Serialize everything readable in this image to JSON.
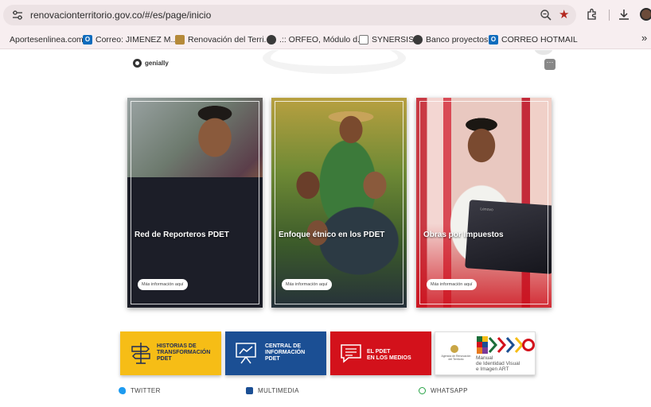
{
  "browser": {
    "url": "renovacionterritorio.gov.co/#/es/page/inicio",
    "bookmarks": [
      {
        "label": "Aportesenlinea.com",
        "icon": "none"
      },
      {
        "label": "Correo: JIMENEZ M...",
        "icon": "outlook-icon"
      },
      {
        "label": "Renovación del Terri...",
        "icon": "shield-icon"
      },
      {
        "label": ".:: ORFEO, Módulo d...",
        "icon": "globe-icon"
      },
      {
        "label": "SYNERSIS",
        "icon": "chart-icon"
      },
      {
        "label": "Banco proyectos",
        "icon": "globe-icon"
      },
      {
        "label": "CORREO HOTMAIL",
        "icon": "outlook-icon"
      }
    ],
    "more_bookmarks": "»"
  },
  "page": {
    "logo_text": "genially",
    "more_button": "···",
    "cards": [
      {
        "title": "Red de Reporteros PDET",
        "button": "Más información aquí"
      },
      {
        "title": "Enfoque étnico en los PDET",
        "button": "Más información aquí"
      },
      {
        "title": "Obras por Impuestos",
        "button": "Más información aquí"
      }
    ],
    "tablet_brand": "Lenovo",
    "banners": [
      {
        "label": "HISTORIAS DE\nTRANSFORMACIÓN\nPDET",
        "color": "#f6bd16"
      },
      {
        "label": "CENTRAL DE\nINFORMACIÓN\nPDET",
        "color": "#1b4f94"
      },
      {
        "label": "EL PDET\nEN LOS MEDIOS",
        "color": "#d3111b"
      },
      {
        "label": "Manual\nde Identidad Visual\ne Imagen ART",
        "agency": "Agencia de Renovación\ndel Territorio",
        "color": "#ffffff"
      }
    ],
    "social": [
      {
        "label": "TWITTER",
        "icon": "twitter-icon"
      },
      {
        "label": "MULTIMEDIA",
        "icon": "multimedia-icon"
      },
      {
        "label": "WHATSAPP",
        "icon": "whatsapp-icon"
      }
    ]
  },
  "colors": {
    "chrome_bg": "#f7eef0",
    "accent_red": "#d3111b",
    "accent_blue": "#1b4f94",
    "accent_yellow": "#f6bd16"
  }
}
